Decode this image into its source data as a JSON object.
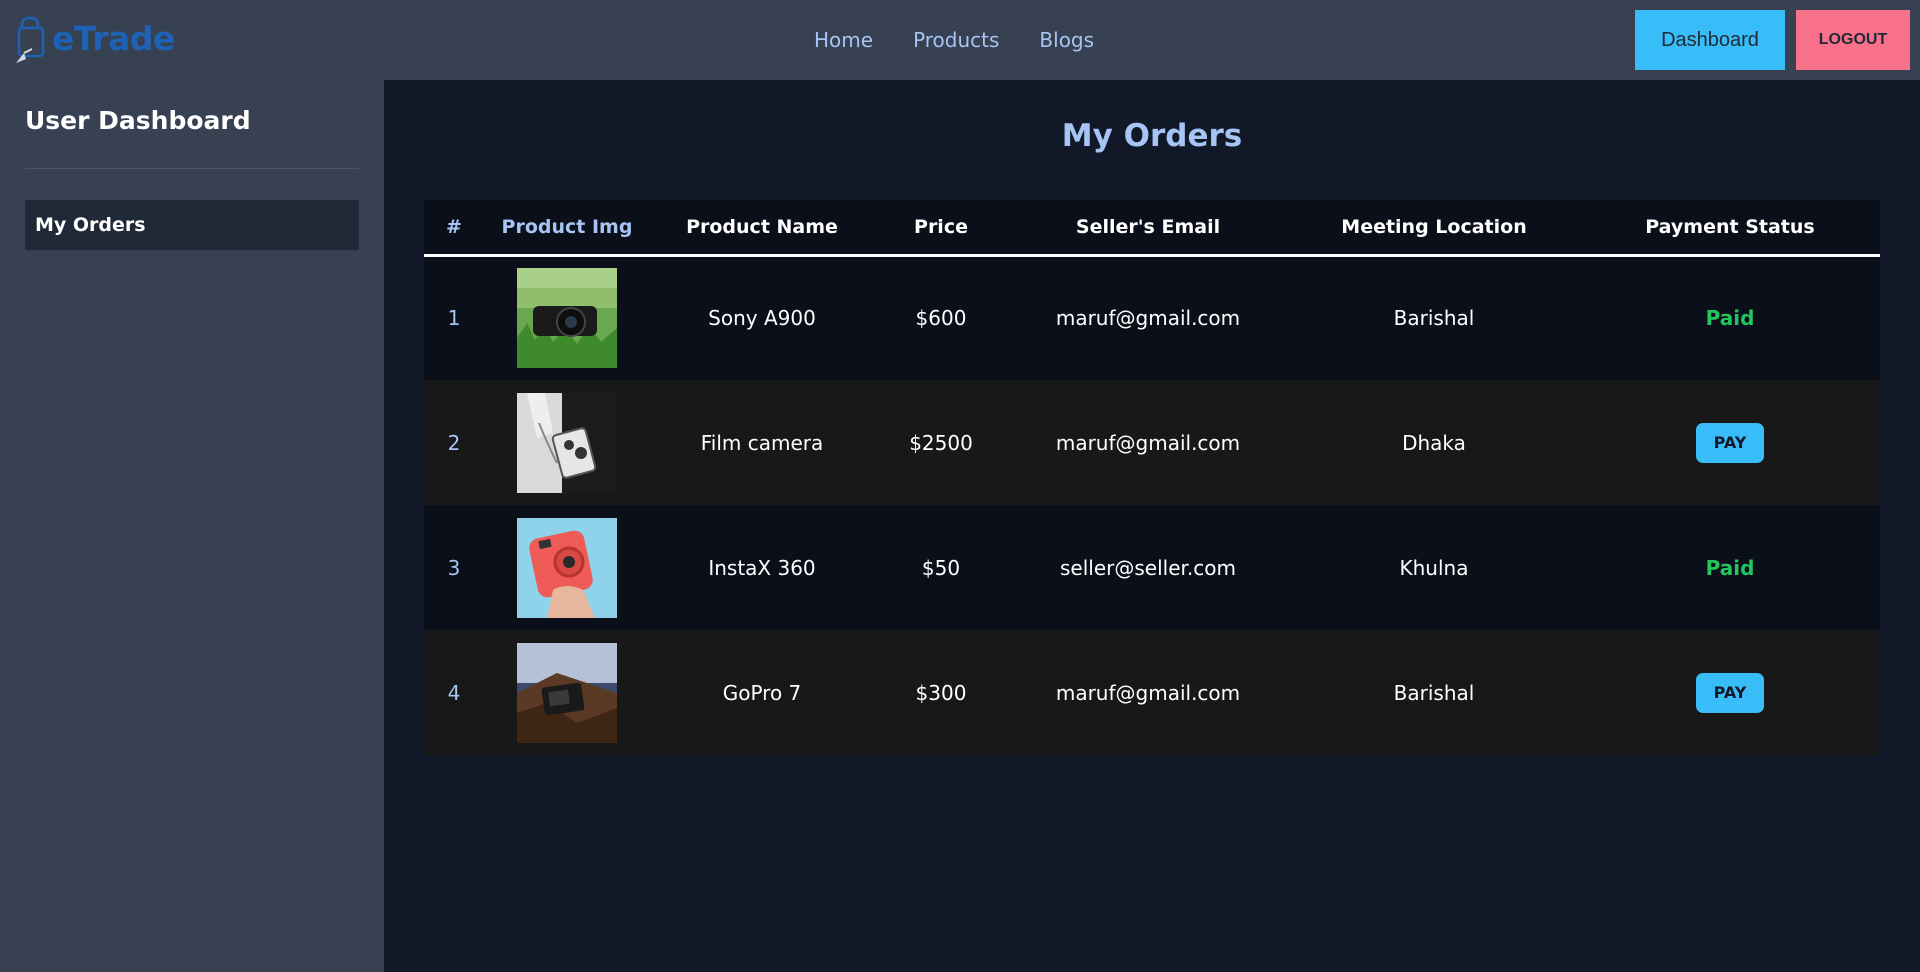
{
  "brand": {
    "name": "eTrade",
    "icon": "shopping-bag-icon"
  },
  "nav": {
    "links": [
      {
        "label": "Home"
      },
      {
        "label": "Products"
      },
      {
        "label": "Blogs"
      }
    ],
    "dashboard_label": "Dashboard",
    "logout_label": "LOGOUT"
  },
  "sidebar": {
    "title": "User Dashboard",
    "items": [
      {
        "label": "My Orders",
        "active": true
      }
    ]
  },
  "main": {
    "title": "My Orders",
    "columns": [
      "#",
      "Product Img",
      "Product Name",
      "Price",
      "Seller's Email",
      "Meeting Location",
      "Payment Status"
    ],
    "orders": [
      {
        "index": "1",
        "image": "camera-on-grass-photo",
        "name": "Sony A900",
        "price": "$600",
        "email": "maruf@gmail.com",
        "location": "Barishal",
        "status": "Paid"
      },
      {
        "index": "2",
        "image": "film-camera-bw-photo",
        "name": "Film camera",
        "price": "$2500",
        "email": "maruf@gmail.com",
        "location": "Dhaka",
        "status": "PAY"
      },
      {
        "index": "3",
        "image": "instax-camera-photo",
        "name": "InstaX 360",
        "price": "$50",
        "email": "seller@seller.com",
        "location": "Khulna",
        "status": "Paid"
      },
      {
        "index": "4",
        "image": "gopro-camera-photo",
        "name": "GoPro 7",
        "price": "$300",
        "email": "maruf@gmail.com",
        "location": "Barishal",
        "status": "PAY"
      }
    ]
  },
  "colors": {
    "nav_bg": "#374151",
    "main_bg": "#111827",
    "accent_blue": "#38bdf8",
    "logout_pink": "#f87188",
    "title_blue": "#a6c4f4",
    "paid_green": "#22c55e"
  }
}
